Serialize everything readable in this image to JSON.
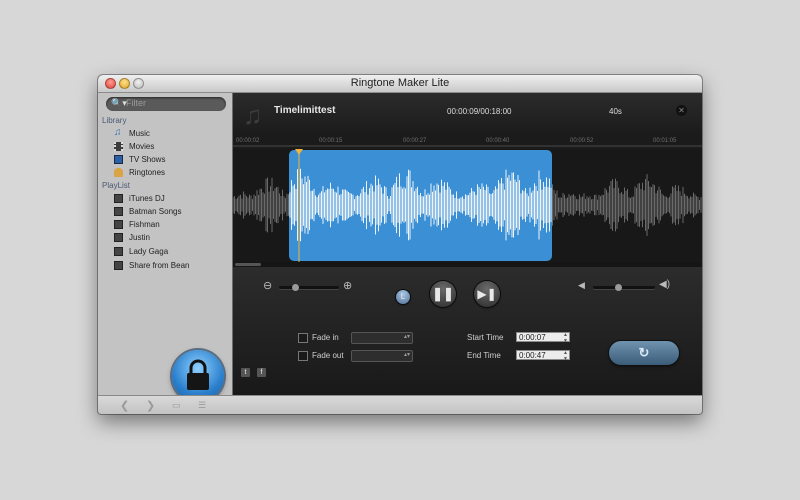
{
  "window": {
    "title": "Ringtone Maker Lite"
  },
  "sidebar": {
    "search": {
      "placeholder": "Filter",
      "icon": "search-icon"
    },
    "library_label": "Library",
    "library": [
      {
        "label": "Music",
        "icon": "music-note-icon"
      },
      {
        "label": "Movies",
        "icon": "film-icon"
      },
      {
        "label": "TV Shows",
        "icon": "tv-icon"
      },
      {
        "label": "Ringtones",
        "icon": "bell-icon"
      }
    ],
    "playlist_label": "PlayList",
    "playlists": [
      {
        "label": "iTunes DJ"
      },
      {
        "label": "Batman Songs"
      },
      {
        "label": "Fishman"
      },
      {
        "label": "Justin"
      },
      {
        "label": "Lady Gaga"
      },
      {
        "label": "Share from Bean"
      }
    ],
    "lock_icon": "lock-icon"
  },
  "header": {
    "track_name": "Timelimittest",
    "timecode": "00:00:09/00:18:00",
    "duration": "40s"
  },
  "ruler": {
    "ticks": [
      "00:00:02",
      "00:00:15",
      "00:00:27",
      "00:00:40",
      "00:00:52",
      "00:01:05"
    ]
  },
  "selection": {
    "start_fraction": 0.12,
    "end_fraction": 0.68,
    "playhead_fraction": 0.14
  },
  "accent_color": "#3b8fd4",
  "controls": {
    "zoom_level": 0.25,
    "volume_level": 0.4,
    "loop_label": "L",
    "fade_in_label": "Fade  in",
    "fade_out_label": "Fade out",
    "start_time_label": "Start Time",
    "end_time_label": "End  Time",
    "start_time": "0:00:07",
    "end_time": "0:00:47"
  }
}
